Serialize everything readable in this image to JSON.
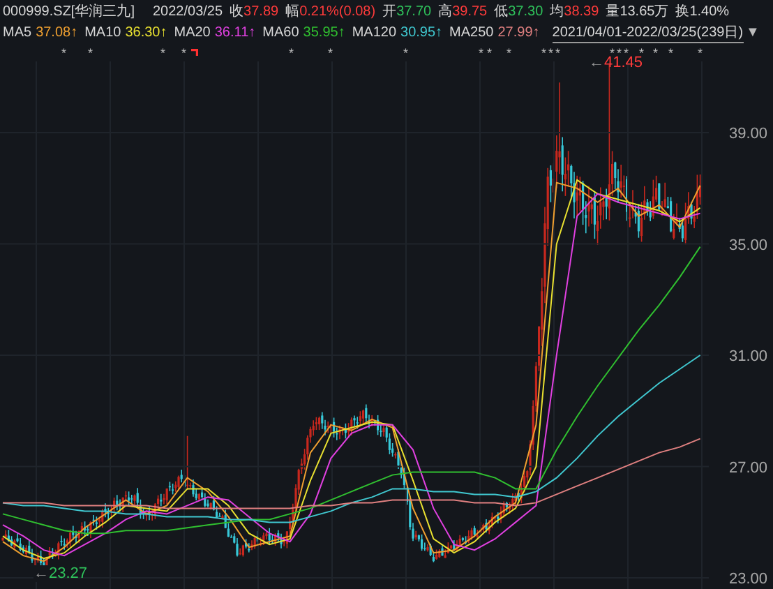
{
  "header": {
    "symbol": "000999.SZ[华润三九]",
    "date": "2022/03/25",
    "quotes": [
      {
        "label": "收",
        "value": "37.89",
        "color": "#ff3b3b"
      },
      {
        "label": "幅",
        "value": "0.21%(0.08)",
        "color": "#ff3b3b"
      },
      {
        "label": "开",
        "value": "37.70",
        "color": "#2fc25b"
      },
      {
        "label": "高",
        "value": "39.75",
        "color": "#ff3b3b"
      },
      {
        "label": "低",
        "value": "37.30",
        "color": "#2fc25b"
      },
      {
        "label": "均",
        "value": "38.39",
        "color": "#ff3b3b"
      },
      {
        "label": "量",
        "value": "13.65万",
        "color": "#d8d8d8"
      },
      {
        "label": "换",
        "value": "1.40%",
        "color": "#d8d8d8"
      }
    ]
  },
  "moving_averages": [
    {
      "value": "37.08↑"
    },
    {
      "value": "36.30↑"
    },
    {
      "value": "36.11↑"
    },
    {
      "value": "35.95↑"
    },
    {
      "value": "30.95↑"
    },
    {
      "value": "27.99↑"
    }
  ],
  "range": {
    "text": "2021/04/01-2022/03/25(239日)",
    "toggle": "▼"
  },
  "event_marks": [
    {
      "kind": "star",
      "text": "*"
    },
    {
      "kind": "star",
      "text": "*"
    },
    {
      "kind": "star",
      "text": "*"
    },
    {
      "kind": "star",
      "text": "*"
    },
    {
      "kind": "flag"
    },
    {
      "kind": "star",
      "text": "*"
    },
    {
      "kind": "star",
      "text": "*"
    },
    {
      "kind": "star",
      "text": "*"
    },
    {
      "kind": "star",
      "text": "*"
    },
    {
      "kind": "star",
      "text": "*"
    },
    {
      "kind": "star",
      "text": "*"
    },
    {
      "kind": "star",
      "text": "*"
    },
    {
      "kind": "star",
      "text": "*"
    },
    {
      "kind": "star",
      "text": "*"
    },
    {
      "kind": "star",
      "text": "*"
    },
    {
      "kind": "star",
      "text": "*"
    },
    {
      "kind": "star",
      "text": "*"
    },
    {
      "kind": "star",
      "text": "*"
    },
    {
      "kind": "star",
      "text": "*"
    },
    {
      "kind": "star",
      "text": "*"
    },
    {
      "kind": "star",
      "text": "*"
    }
  ],
  "chart": {
    "chart_data": {
      "type": "line",
      "grid": true,
      "ylim": [
        22.6,
        41.56
      ],
      "yticks": [
        {
          "value": 39,
          "label": "39.00"
        },
        {
          "value": 35,
          "label": "35.00"
        },
        {
          "value": 31,
          "label": "31.00"
        },
        {
          "value": 27,
          "label": "27.00"
        },
        {
          "value": 23,
          "label": "23.00"
        }
      ],
      "series": [
        {
          "name": "MA5",
          "color": "#f0a030",
          "values": [
            24.3,
            23.8,
            23.6,
            24.1,
            24.8,
            25.3,
            25.8,
            25.3,
            25.6,
            26.6,
            26.1,
            25.2,
            24.1,
            24.3,
            24.5,
            27.5,
            28.5,
            28.3,
            28.7,
            28.4,
            25.5,
            23.9,
            24.0,
            24.5,
            25.2,
            25.7,
            28.5,
            37.2,
            37.0,
            36.5,
            37.0,
            36.0,
            36.4,
            35.6,
            37.1
          ]
        },
        {
          "name": "MA10",
          "color": "#e8e030",
          "values": [
            24.5,
            24.0,
            23.7,
            23.9,
            24.5,
            25.0,
            25.6,
            25.5,
            25.4,
            26.2,
            26.2,
            25.6,
            24.6,
            24.2,
            24.4,
            26.5,
            28.2,
            28.4,
            28.6,
            28.5,
            26.5,
            24.4,
            23.9,
            24.3,
            25.0,
            25.5,
            27.0,
            35.0,
            37.3,
            36.8,
            36.6,
            36.4,
            36.2,
            35.8,
            36.3
          ]
        },
        {
          "name": "MA20",
          "color": "#e040e0",
          "values": [
            24.9,
            24.5,
            24.0,
            23.8,
            24.2,
            24.6,
            25.1,
            25.4,
            25.3,
            25.6,
            25.9,
            25.8,
            25.2,
            24.6,
            24.3,
            25.3,
            27.3,
            28.2,
            28.5,
            28.5,
            27.6,
            25.5,
            24.2,
            24.0,
            24.4,
            25.0,
            25.6,
            31.0,
            36.0,
            36.8,
            36.5,
            36.3,
            36.1,
            35.9,
            36.1
          ]
        },
        {
          "name": "MA60",
          "color": "#30c030",
          "values": [
            25.3,
            25.1,
            24.9,
            24.7,
            24.6,
            24.6,
            24.7,
            24.7,
            24.7,
            24.8,
            24.9,
            25.0,
            25.1,
            25.1,
            25.3,
            25.5,
            25.8,
            26.1,
            26.4,
            26.7,
            26.8,
            26.8,
            26.8,
            26.8,
            26.6,
            26.2,
            26.2,
            27.6,
            28.8,
            29.9,
            30.9,
            31.9,
            32.8,
            33.8,
            34.9
          ]
        },
        {
          "name": "MA120",
          "color": "#40c8d0",
          "values": [
            25.7,
            25.6,
            25.6,
            25.5,
            25.4,
            25.4,
            25.3,
            25.3,
            25.2,
            25.2,
            25.2,
            25.1,
            25.1,
            25.0,
            25.0,
            25.2,
            25.4,
            25.7,
            25.9,
            26.2,
            26.2,
            26.1,
            26.1,
            26.0,
            26.0,
            25.9,
            26.1,
            26.6,
            27.3,
            28.1,
            28.8,
            29.4,
            30.0,
            30.5,
            31.0
          ]
        },
        {
          "name": "MA250",
          "color": "#e08080",
          "values": [
            25.7,
            25.7,
            25.7,
            25.6,
            25.6,
            25.6,
            25.6,
            25.6,
            25.5,
            25.5,
            25.5,
            25.5,
            25.5,
            25.5,
            25.5,
            25.6,
            25.6,
            25.7,
            25.7,
            25.8,
            25.8,
            25.8,
            25.8,
            25.7,
            25.7,
            25.6,
            25.7,
            26.0,
            26.3,
            26.6,
            26.9,
            27.2,
            27.5,
            27.7,
            28.0
          ]
        }
      ]
    }
  },
  "high_label": {
    "arrow": "←",
    "value": "41.45"
  },
  "low_label": {
    "arrow": "←",
    "value": "23.27"
  }
}
